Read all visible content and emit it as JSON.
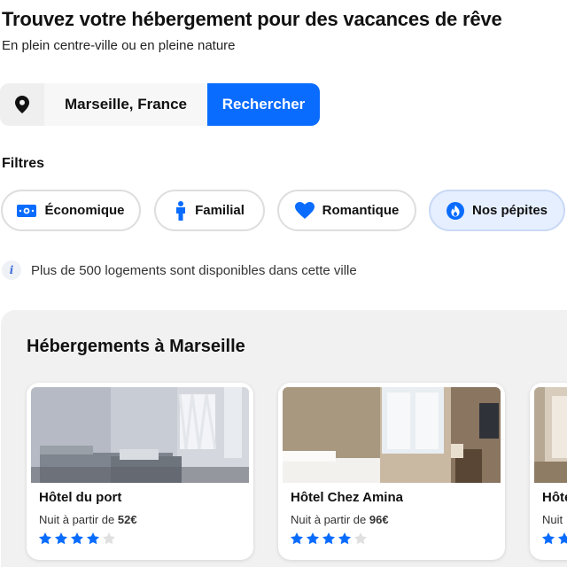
{
  "header": {
    "title": "Trouvez votre hébergement pour des vacances de rêve",
    "subtitle": "En plein centre-ville ou en pleine nature"
  },
  "search": {
    "icon": "location-pin-icon",
    "value": "Marseille, France",
    "button_label": "Rechercher"
  },
  "filters": {
    "label": "Filtres",
    "chips": [
      {
        "label": "Économique",
        "icon": "money-icon",
        "active": false
      },
      {
        "label": "Familial",
        "icon": "person-icon",
        "active": false
      },
      {
        "label": "Romantique",
        "icon": "heart-icon",
        "active": false
      },
      {
        "label": "Nos pépites",
        "icon": "flame-icon",
        "active": true
      }
    ]
  },
  "info": {
    "icon": "info-icon",
    "text": "Plus de 500 logements sont disponibles dans cette ville"
  },
  "listings": {
    "title": "Hébergements à Marseille",
    "cards": [
      {
        "name": "Hôtel du port",
        "price_prefix": "Nuit à partir de ",
        "price": "52€",
        "rating": 4,
        "max_rating": 5
      },
      {
        "name": "Hôtel Chez Amina",
        "price_prefix": "Nuit à partir de ",
        "price": "96€",
        "rating": 4,
        "max_rating": 5
      },
      {
        "name": "Hôtel",
        "price_prefix": "Nuit",
        "price": "",
        "rating": 2,
        "max_rating": 5
      }
    ]
  },
  "colors": {
    "accent": "#0a6cff",
    "star_filled": "#0a6cff",
    "star_empty": "#e0e0e0",
    "panel_bg": "#f1f1f1",
    "active_chip_bg": "#e6efff"
  }
}
